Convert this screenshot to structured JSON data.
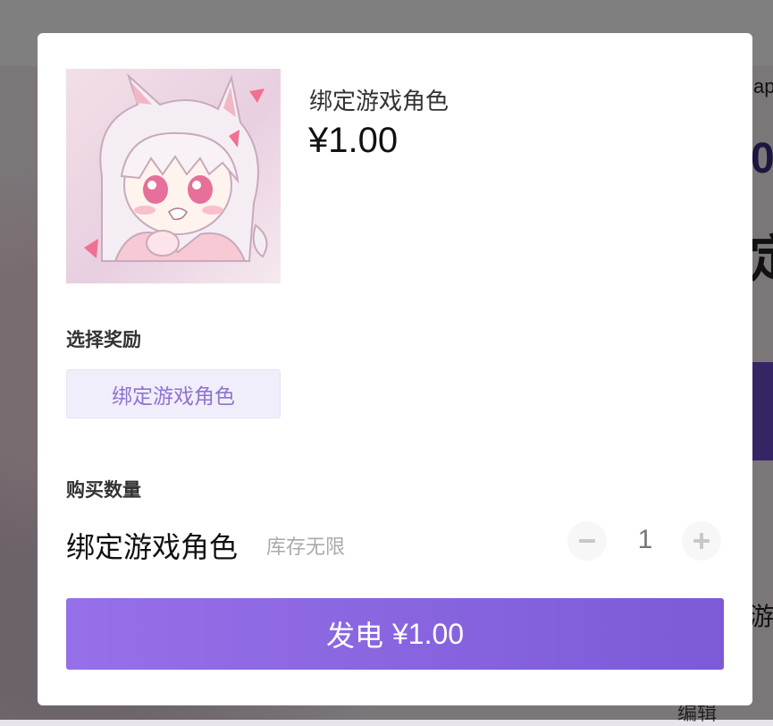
{
  "background": {
    "partial_texts": [
      "ap",
      "0",
      "定",
      "游",
      "编辑"
    ]
  },
  "product": {
    "name": "绑定游戏角色",
    "price": "¥1.00",
    "cover_image": "anime-catgirl-avatar"
  },
  "reward_section": {
    "title": "选择奖励",
    "options": [
      "绑定游戏角色"
    ],
    "selected": "绑定游戏角色"
  },
  "quantity_section": {
    "title": "购买数量",
    "item_name": "绑定游戏角色",
    "stock": "库存无限",
    "quantity": "1"
  },
  "pay_button": {
    "label": "发电",
    "amount": "¥1.00"
  },
  "colors": {
    "accent": "#8e74d0",
    "button_start": "#9670e8",
    "button_end": "#7c5ad8",
    "chip_bg": "#f1eefb"
  }
}
